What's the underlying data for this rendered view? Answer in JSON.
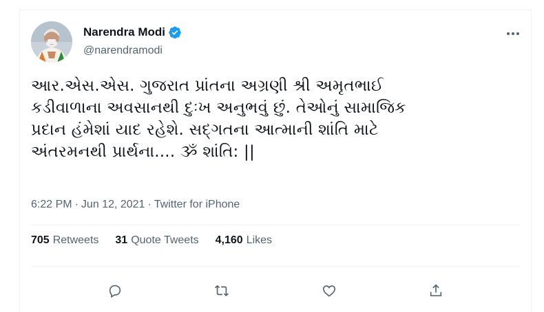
{
  "author": {
    "name": "Narendra Modi",
    "handle": "@narendramodi",
    "verified": true
  },
  "tweet": {
    "text": "આર.એસ.એસ. ગુજરાત પ્રાંતના અગ્રણી શ્રી અમૃતભાઈ\nકડીવાળાના અવસાનથી દુઃખ અનુભવું છું. તેઓનું સામાજિક\nપ્રદાન હંમેશાં યાદ રહેશે. સદ્ગતના આત્માની શાંતિ માટે\nઅંતરમનથી પ્રાર્થના.... ૐ શાંતિ: ||",
    "time": "6:22 PM",
    "separator1": "·",
    "date": "Jun 12, 2021",
    "separator2": "·",
    "source": "Twitter for iPhone"
  },
  "stats": {
    "retweets_count": "705",
    "retweets_label": "Retweets",
    "quotes_count": "31",
    "quotes_label": "Quote Tweets",
    "likes_count": "4,160",
    "likes_label": "Likes"
  },
  "icons": {
    "more": "more-icon",
    "reply": "reply-icon",
    "retweet": "retweet-icon",
    "like": "like-icon",
    "share": "share-icon",
    "verified": "verified-badge-icon"
  },
  "colors": {
    "text": "#0f1419",
    "secondary": "#536471",
    "verified": "#1d9bf0",
    "border": "#eff3f4"
  }
}
